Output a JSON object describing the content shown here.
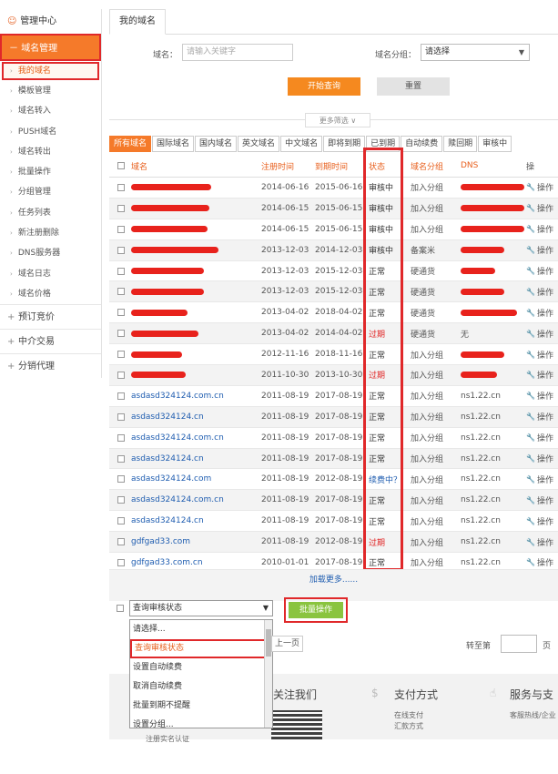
{
  "sidebar": {
    "header": "管理中心",
    "group": "域名管理",
    "items": [
      {
        "label": "我的域名",
        "active": true
      },
      {
        "label": "模板管理"
      },
      {
        "label": "域名转入"
      },
      {
        "label": "PUSH域名"
      },
      {
        "label": "域名转出"
      },
      {
        "label": "批量操作"
      },
      {
        "label": "分组管理"
      },
      {
        "label": "任务列表"
      },
      {
        "label": "新注册删除"
      },
      {
        "label": "DNS服务器"
      },
      {
        "label": "域名日志"
      },
      {
        "label": "域名价格"
      }
    ],
    "sections": [
      "预订竞价",
      "中介交易",
      "分销代理"
    ]
  },
  "main": {
    "tab": "我的域名",
    "domain_label": "域名：",
    "domain_placeholder": "请输入关键字",
    "group_label": "域名分组：",
    "group_value": "请选择",
    "search_btn": "开始查询",
    "reset_btn": "重置",
    "more_filter": "更多筛选 ∨",
    "filter_tabs": [
      "所有域名",
      "国际域名",
      "国内域名",
      "英文域名",
      "中文域名",
      "即将到期",
      "已到期",
      "自动续费",
      "赎回期",
      "审核中"
    ],
    "columns": {
      "name": "域名",
      "reg": "注册时间",
      "exp": "到期时间",
      "status": "状态",
      "group": "域名分组",
      "dns": "DNS",
      "op": "操"
    },
    "rows": [
      {
        "name": "",
        "reg": "2014-06-16",
        "exp": "2015-06-16",
        "status": "审核中",
        "group": "加入分组",
        "dns": "",
        "op": "操作"
      },
      {
        "name": "",
        "reg": "2014-06-15",
        "exp": "2015-06-15",
        "status": "审核中",
        "group": "加入分组",
        "dns": "",
        "op": "操作"
      },
      {
        "name": "",
        "reg": "2014-06-15",
        "exp": "2015-06-15",
        "status": "审核中",
        "group": "加入分组",
        "dns": "",
        "op": "操作"
      },
      {
        "name": "",
        "reg": "2013-12-03",
        "exp": "2014-12-03",
        "status": "审核中",
        "group": "备案米",
        "dns": "",
        "op": "操作"
      },
      {
        "name": "",
        "reg": "2013-12-03",
        "exp": "2015-12-03",
        "status": "正常",
        "group": "硬通货",
        "dns": "",
        "op": "操作"
      },
      {
        "name": "",
        "reg": "2013-12-03",
        "exp": "2015-12-03",
        "status": "正常",
        "group": "硬通货",
        "dns": "",
        "op": "操作"
      },
      {
        "name": "",
        "reg": "2013-04-02",
        "exp": "2018-04-02",
        "status": "正常",
        "group": "硬通货",
        "dns": "",
        "op": "操作"
      },
      {
        "name": "",
        "reg": "2013-04-02",
        "exp": "2014-04-02",
        "status": "过期",
        "group": "硬通货",
        "dns": "无",
        "op": "操作"
      },
      {
        "name": "",
        "reg": "2012-11-16",
        "exp": "2018-11-16",
        "status": "正常",
        "group": "加入分组",
        "dns": "",
        "op": "操作"
      },
      {
        "name": "",
        "reg": "2011-10-30",
        "exp": "2013-10-30",
        "status": "过期",
        "group": "加入分组",
        "dns": "",
        "op": "操作"
      },
      {
        "name": "asdasd324124.com.cn",
        "reg": "2011-08-19",
        "exp": "2017-08-19",
        "status": "正常",
        "group": "加入分组",
        "dns": "ns1.22.cn",
        "op": "操作"
      },
      {
        "name": "asdasd324124.cn",
        "reg": "2011-08-19",
        "exp": "2017-08-19",
        "status": "正常",
        "group": "加入分组",
        "dns": "ns1.22.cn",
        "op": "操作"
      },
      {
        "name": "asdasd324124.com.cn",
        "reg": "2011-08-19",
        "exp": "2017-08-19",
        "status": "正常",
        "group": "加入分组",
        "dns": "ns1.22.cn",
        "op": "操作"
      },
      {
        "name": "asdasd324124.cn",
        "reg": "2011-08-19",
        "exp": "2017-08-19",
        "status": "正常",
        "group": "加入分组",
        "dns": "ns1.22.cn",
        "op": "操作"
      },
      {
        "name": "asdasd324124.com",
        "reg": "2011-08-19",
        "exp": "2012-08-19",
        "status": "续费中？",
        "group": "加入分组",
        "dns": "ns1.22.cn",
        "op": "操作"
      },
      {
        "name": "asdasd324124.com.cn",
        "reg": "2011-08-19",
        "exp": "2017-08-19",
        "status": "正常",
        "group": "加入分组",
        "dns": "ns1.22.cn",
        "op": "操作"
      },
      {
        "name": "asdasd324124.cn",
        "reg": "2011-08-19",
        "exp": "2017-08-19",
        "status": "正常",
        "group": "加入分组",
        "dns": "ns1.22.cn",
        "op": "操作"
      },
      {
        "name": "gdfgad33.com",
        "reg": "2011-08-19",
        "exp": "2012-08-19",
        "status": "过期",
        "group": "加入分组",
        "dns": "ns1.22.cn",
        "op": "操作"
      },
      {
        "name": "gdfgad33.com.cn",
        "reg": "2010-01-01",
        "exp": "2017-08-19",
        "status": "正常",
        "group": "加入分组",
        "dns": "ns1.22.cn",
        "op": "操作"
      }
    ],
    "load_more": "加载更多......",
    "batch_select": "查询审核状态",
    "batch_btn": "批量操作",
    "dropdown_options": [
      "请选择...",
      "查询审核状态",
      "设置自动续费",
      "取消自动续费",
      "批量到期不提醒",
      "设置分组..."
    ],
    "prev_page": "上一页",
    "goto_label": "转至第",
    "page_label": "页"
  },
  "footer": {
    "follow": "关注我们",
    "pay": "支付方式",
    "pay_online": "在线支付",
    "pay_transfer": "汇款方式",
    "service": "服务与支",
    "hotline": "客服热线/企业",
    "reg_verify": "注册实名认证"
  },
  "colors": {
    "accent": "#f57a2a",
    "highlight": "#e0282a",
    "link": "#1f5db0",
    "batch": "#8ac43f"
  }
}
